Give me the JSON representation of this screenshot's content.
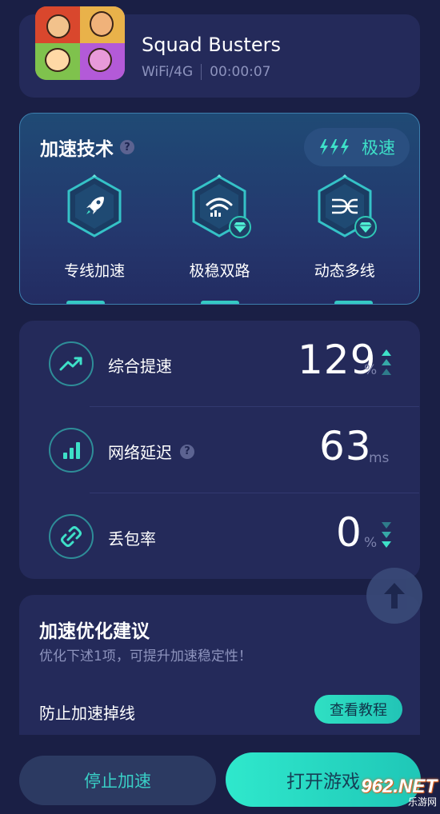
{
  "game": {
    "name": "Squad Busters",
    "network": "WiFi/4G",
    "timer": "00:00:07",
    "icon": "game-cover-icon"
  },
  "tech": {
    "title": "加速技术",
    "help_icon": "question-icon",
    "mode_label": "极速",
    "mode_icon": "triple-bolt-icon",
    "items": [
      {
        "label": "专线加速",
        "icon": "rocket-icon",
        "premium": false
      },
      {
        "label": "极稳双路",
        "icon": "wifi-dual-icon",
        "premium": true
      },
      {
        "label": "动态多线",
        "icon": "multi-line-icon",
        "premium": true
      }
    ]
  },
  "stats": {
    "speedup": {
      "label": "综合提速",
      "value": "129",
      "unit": "%",
      "icon": "trend-up-icon",
      "trend": "up"
    },
    "latency": {
      "label": "网络延迟",
      "value": "63",
      "unit": "ms",
      "icon": "signal-bars-icon"
    },
    "loss": {
      "label": "丢包率",
      "value": "0",
      "unit": "%",
      "icon": "broken-link-icon",
      "trend": "down"
    }
  },
  "suggestion": {
    "title": "加速优化建议",
    "subtitle": "优化下述1项，可提升加速稳定性！",
    "item_label": "防止加速掉线",
    "button_label": "查看教程"
  },
  "actions": {
    "stop_label": "停止加速",
    "open_label": "打开游戏"
  },
  "watermark": {
    "main": "962.NET",
    "sub": "乐游网"
  },
  "colors": {
    "accent": "#2fe0c3",
    "background": "#1a1f45",
    "card": "#242a5a"
  }
}
